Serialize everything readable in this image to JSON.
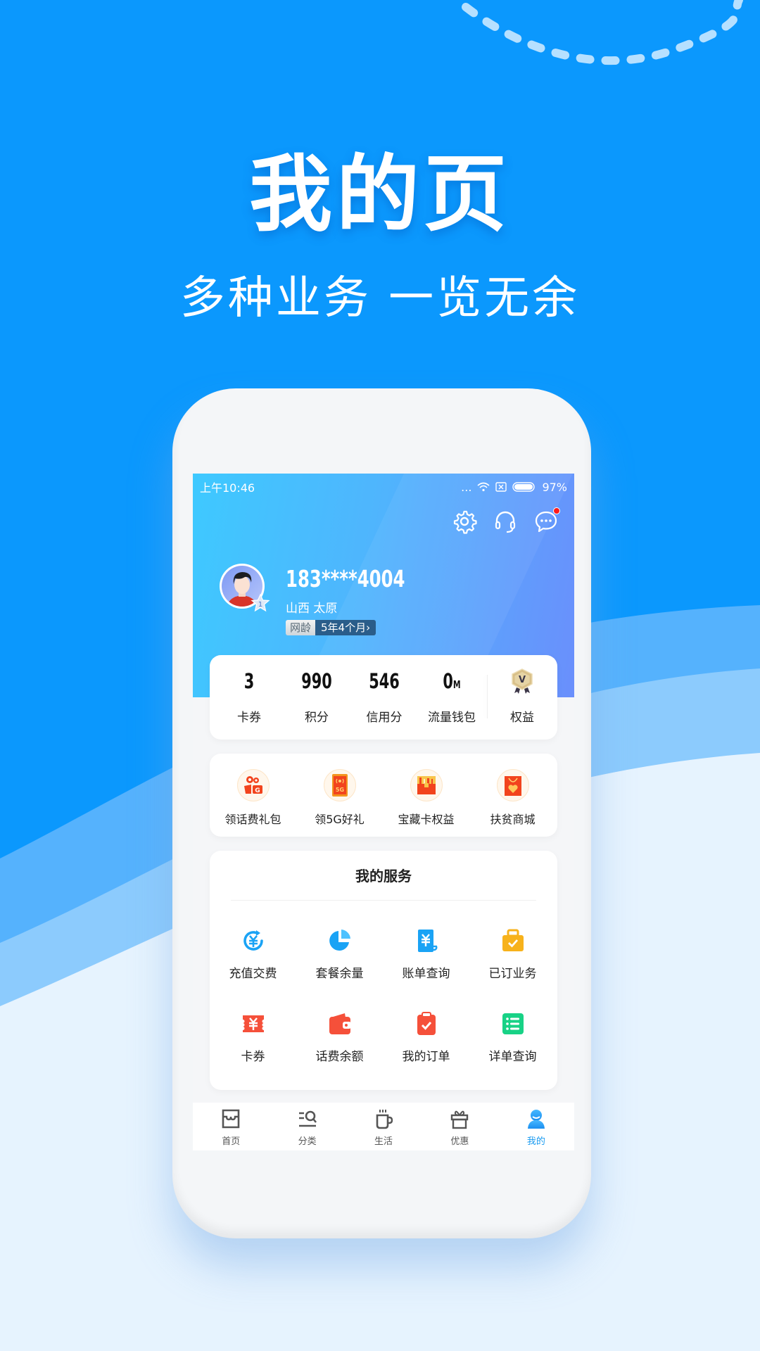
{
  "promo": {
    "title": "我的页",
    "subtitle": "多种业务 一览无余"
  },
  "status_bar": {
    "time": "上午10:46",
    "signal": "...",
    "battery": "97%"
  },
  "header": {
    "actions": [
      {
        "icon": "gear-icon",
        "label": "设置"
      },
      {
        "icon": "headset-icon",
        "label": "客服"
      },
      {
        "icon": "message-icon",
        "label": "消息",
        "has_badge": true
      }
    ],
    "user": {
      "phone": "183****4004",
      "location": "山西  太原",
      "level": "1",
      "net_age_label": "网龄",
      "net_age_value": "5年4个月",
      "net_age_chevron": "›"
    }
  },
  "stats": [
    {
      "value": "3",
      "unit": "",
      "label": "卡券"
    },
    {
      "value": "990",
      "unit": "",
      "label": "积分"
    },
    {
      "value": "546",
      "unit": "",
      "label": "信用分"
    },
    {
      "value": "0",
      "unit": "M",
      "label": "流量钱包"
    }
  ],
  "rights": {
    "label": "权益",
    "badge_letter": "V"
  },
  "promos": [
    {
      "label": "领话费礼包",
      "icon": "gift-video-icon"
    },
    {
      "label": "领5G好礼",
      "icon": "phone-5g-icon",
      "icon_text": "5G"
    },
    {
      "label": "宝藏卡权益",
      "icon": "treasure-chest-icon"
    },
    {
      "label": "扶贫商城",
      "icon": "shopping-bag-heart-icon"
    }
  ],
  "services": {
    "title": "我的服务",
    "items": [
      {
        "label": "充值交费",
        "icon": "recharge-icon",
        "color": "#1aa3f5"
      },
      {
        "label": "套餐余量",
        "icon": "pie-chart-icon",
        "color": "#1aa3f5"
      },
      {
        "label": "账单查询",
        "icon": "bill-icon",
        "color": "#1aa3f5"
      },
      {
        "label": "已订业务",
        "icon": "briefcase-check-icon",
        "color": "#f7b21b"
      },
      {
        "label": "卡券",
        "icon": "coupon-icon",
        "color": "#f5503a"
      },
      {
        "label": "话费余额",
        "icon": "wallet-icon",
        "color": "#f5503a"
      },
      {
        "label": "我的订单",
        "icon": "clipboard-check-icon",
        "color": "#f5503a"
      },
      {
        "label": "详单查询",
        "icon": "list-icon",
        "color": "#18d286"
      }
    ]
  },
  "tabbar": {
    "active_index": 4,
    "active_color": "#1a9bf0",
    "items": [
      {
        "label": "首页",
        "icon": "home-store-icon"
      },
      {
        "label": "分类",
        "icon": "category-search-icon"
      },
      {
        "label": "生活",
        "icon": "cup-icon"
      },
      {
        "label": "优惠",
        "icon": "gift-box-icon"
      },
      {
        "label": "我的",
        "icon": "user-icon"
      }
    ]
  }
}
